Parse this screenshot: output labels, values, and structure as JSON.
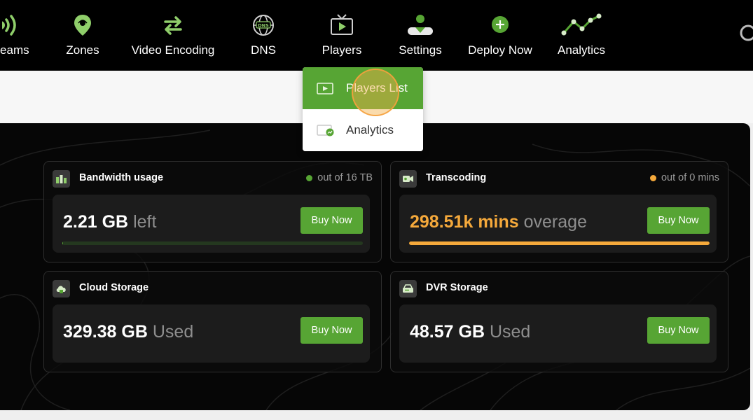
{
  "nav": {
    "items": [
      {
        "label": "reams",
        "icon": "broadcast-icon"
      },
      {
        "label": "Zones",
        "icon": "location-pin-icon"
      },
      {
        "label": "Video Encoding",
        "icon": "encoding-arrows-icon"
      },
      {
        "label": "DNS",
        "icon": "dns-globe-icon"
      },
      {
        "label": "Players",
        "icon": "tv-player-icon"
      },
      {
        "label": "Settings",
        "icon": "user-settings-icon"
      },
      {
        "label": "Deploy Now",
        "icon": "plus-circle-icon"
      },
      {
        "label": "Analytics",
        "icon": "line-chart-icon"
      }
    ]
  },
  "dropdown": {
    "items": [
      {
        "label": "Players List",
        "icon": "player-screen-icon"
      },
      {
        "label": "Analytics",
        "icon": "player-analytics-icon"
      }
    ]
  },
  "cards": {
    "bandwidth": {
      "title": "Bandwidth usage",
      "quota": "out of 16 TB",
      "value": "2.21 GB",
      "suffix": "left",
      "button": "Buy Now",
      "progress": 0.002,
      "status_color": "#57a534"
    },
    "transcoding": {
      "title": "Transcoding",
      "quota": "out of 0 mins",
      "value": "298.51k mins",
      "suffix": "overage",
      "button": "Buy Now",
      "progress": 1.0,
      "status_color": "#f5a93b"
    },
    "cloud": {
      "title": "Cloud Storage",
      "value": "329.38 GB",
      "suffix": "Used",
      "button": "Buy Now"
    },
    "dvr": {
      "title": "DVR Storage",
      "value": "48.57 GB",
      "suffix": "Used",
      "button": "Buy Now"
    }
  },
  "colors": {
    "accent_green": "#57a534",
    "warning_orange": "#f5a93b",
    "nav_background": "#000000"
  }
}
